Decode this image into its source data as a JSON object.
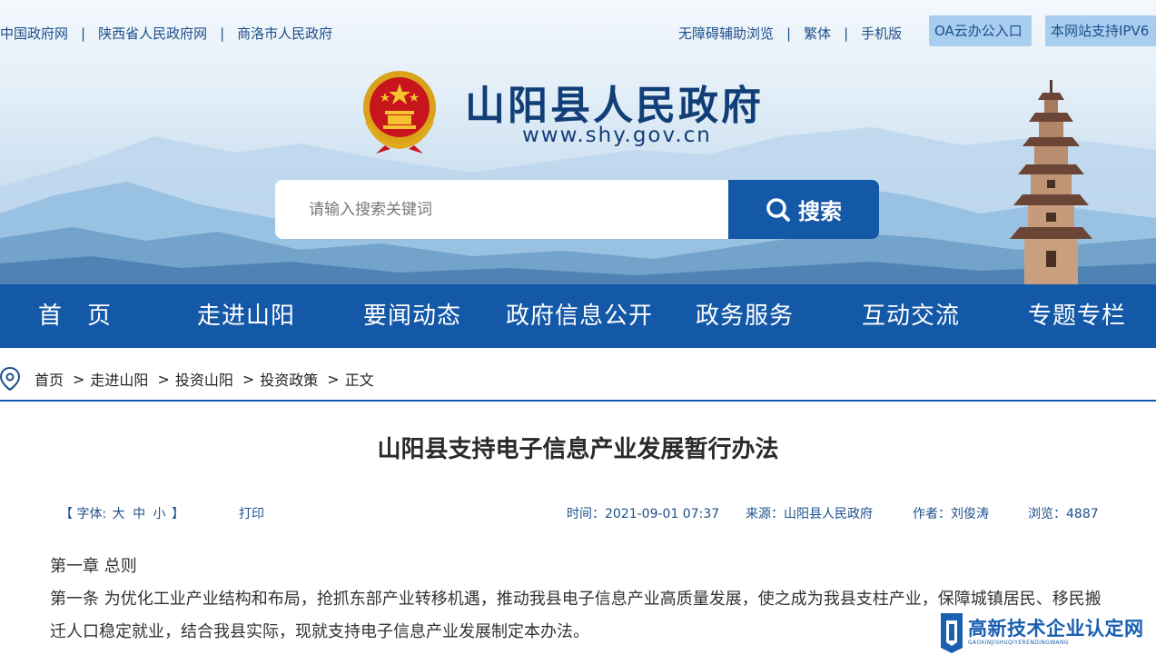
{
  "toplinks": {
    "left": [
      "中国政府网",
      "陕西省人民政府网",
      "商洛市人民政府"
    ],
    "right": [
      "无障碍辅助浏览",
      "繁体",
      "手机版"
    ],
    "separator": "|",
    "oa_button": "OA云办公入口",
    "ipv6_badge": "本网站支持IPV6"
  },
  "site": {
    "title": "山阳县人民政府",
    "url": "www.shy.gov.cn"
  },
  "search": {
    "placeholder": "请输入搜索关键词",
    "button_label": "搜索"
  },
  "nav": {
    "items": [
      "首　页",
      "走进山阳",
      "要闻动态",
      "政府信息公开",
      "政务服务",
      "互动交流",
      "专题专栏"
    ]
  },
  "breadcrumb": {
    "items": [
      "首页",
      "走进山阳",
      "投资山阳",
      "投资政策",
      "正文"
    ],
    "arrow": ">"
  },
  "article": {
    "title": "山阳县支持电子信息产业发展暂行办法",
    "font_label": "【 字体:",
    "font_sizes": [
      "大",
      "中",
      "小"
    ],
    "font_close": "】",
    "print_label": "打印",
    "time": "时间：2021-09-01 07:37",
    "source": "来源：山阳县人民政府",
    "author": "作者：刘俊涛",
    "views": "浏览：4887",
    "paragraphs": [
      "第一章 总则",
      "第一条 为优化工业产业结构和布局，抢抓东部产业转移机遇，推动我县电子信息产业高质量发展，使之成为我县支柱产业，保障城镇居民、移民搬",
      "迁人口稳定就业，结合我县实际，现就支持电子信息产业发展制定本办法。"
    ]
  },
  "watermark": {
    "main": "高新技术企业认定网",
    "sub": "GAOXINJISHUQIYERENDINGWANG"
  },
  "colors": {
    "primary_blue": "#1458a8",
    "link_blue": "#1d4f8c",
    "title_navy": "#123e78",
    "pill_bg": "#a9cdee"
  }
}
